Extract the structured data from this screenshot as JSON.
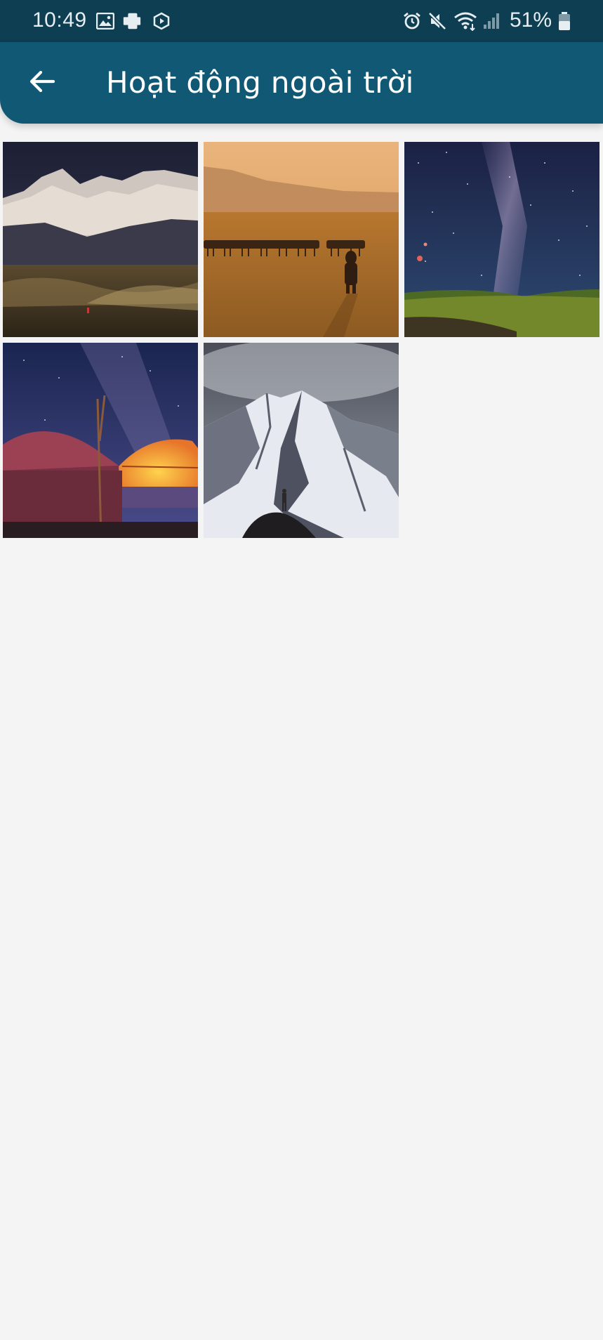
{
  "status_bar": {
    "time": "10:49",
    "battery": "51%",
    "icons": [
      "gallery-icon",
      "phone-sync-icon",
      "hexagon-app-icon",
      "alarm-icon",
      "mute-icon",
      "wifi-icon",
      "signal-icon",
      "battery-icon"
    ]
  },
  "app_bar": {
    "title": "Hoạt động ngoài trời",
    "back_icon": "arrow-left-icon",
    "background": "#105873"
  },
  "colors": {
    "status_bar": "#0e3e52",
    "app_bar": "#105873",
    "page_background": "#f4f4f4"
  },
  "gallery": {
    "photos": [
      {
        "subject": "snowy-mountain-range-valley"
      },
      {
        "subject": "horses-on-golden-steppe-with-child"
      },
      {
        "subject": "milky-way-over-green-hill"
      },
      {
        "subject": "yurts-under-starry-night"
      },
      {
        "subject": "climber-facing-snow-peak"
      }
    ]
  }
}
